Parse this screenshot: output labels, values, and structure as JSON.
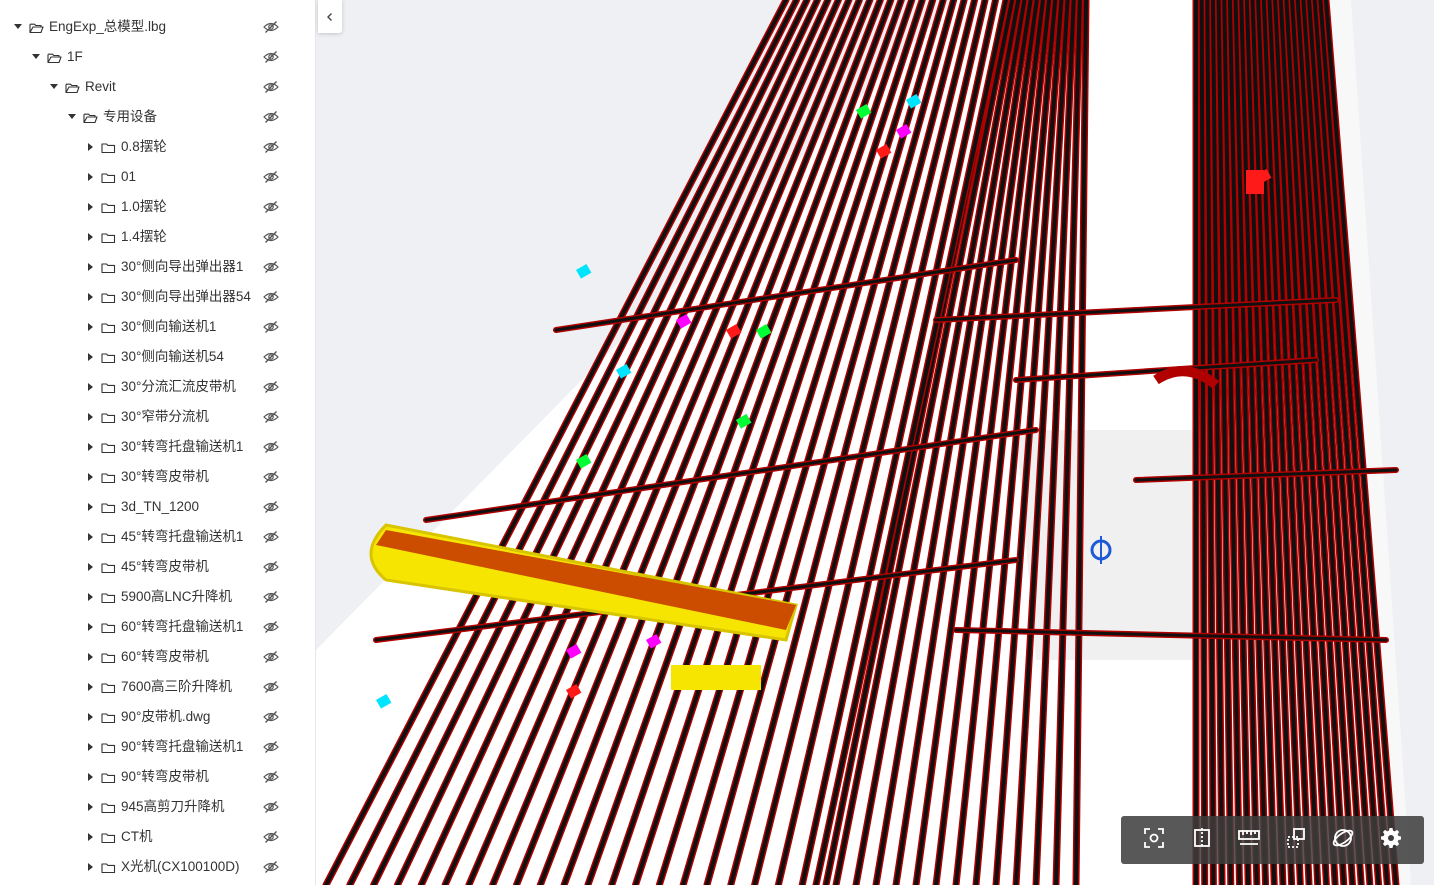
{
  "tree": {
    "items": [
      {
        "label": "EngExp_总模型.lbg",
        "level": 0,
        "expanded": true
      },
      {
        "label": "1F",
        "level": 1,
        "expanded": true
      },
      {
        "label": "Revit",
        "level": 2,
        "expanded": true
      },
      {
        "label": "专用设备",
        "level": 3,
        "expanded": true
      },
      {
        "label": "0.8摆轮",
        "level": 4,
        "expanded": false
      },
      {
        "label": "01",
        "level": 4,
        "expanded": false
      },
      {
        "label": "1.0摆轮",
        "level": 4,
        "expanded": false
      },
      {
        "label": "1.4摆轮",
        "level": 4,
        "expanded": false
      },
      {
        "label": "30°侧向导出弹出器1",
        "level": 4,
        "expanded": false
      },
      {
        "label": "30°侧向导出弹出器54",
        "level": 4,
        "expanded": false
      },
      {
        "label": "30°侧向输送机1",
        "level": 4,
        "expanded": false
      },
      {
        "label": "30°侧向输送机54",
        "level": 4,
        "expanded": false
      },
      {
        "label": "30°分流汇流皮带机",
        "level": 4,
        "expanded": false
      },
      {
        "label": "30°窄带分流机",
        "level": 4,
        "expanded": false
      },
      {
        "label": "30°转弯托盘输送机1",
        "level": 4,
        "expanded": false
      },
      {
        "label": "30°转弯皮带机",
        "level": 4,
        "expanded": false
      },
      {
        "label": "3d_TN_1200",
        "level": 4,
        "expanded": false
      },
      {
        "label": "45°转弯托盘输送机1",
        "level": 4,
        "expanded": false
      },
      {
        "label": "45°转弯皮带机",
        "level": 4,
        "expanded": false
      },
      {
        "label": "5900高LNC升降机",
        "level": 4,
        "expanded": false
      },
      {
        "label": "60°转弯托盘输送机1",
        "level": 4,
        "expanded": false
      },
      {
        "label": "60°转弯皮带机",
        "level": 4,
        "expanded": false
      },
      {
        "label": "7600高三阶升降机",
        "level": 4,
        "expanded": false
      },
      {
        "label": "90°皮带机.dwg",
        "level": 4,
        "expanded": false
      },
      {
        "label": "90°转弯托盘输送机1",
        "level": 4,
        "expanded": false
      },
      {
        "label": "90°转弯皮带机",
        "level": 4,
        "expanded": false
      },
      {
        "label": "945高剪刀升降机",
        "level": 4,
        "expanded": false
      },
      {
        "label": "CT机",
        "level": 4,
        "expanded": false
      },
      {
        "label": "X光机(CX100100D)",
        "level": 4,
        "expanded": false
      }
    ]
  },
  "icons": {
    "caret_expanded": "caret-down-icon",
    "caret_collapsed": "caret-right-icon",
    "folder_open": "folder-open-icon",
    "folder_closed": "folder-icon",
    "visibility": "eye-slash-icon",
    "collapse": "chevron-left-icon"
  },
  "toolbar": {
    "tools": [
      {
        "icon": "focus-icon"
      },
      {
        "icon": "section-box-icon"
      },
      {
        "icon": "measure-icon"
      },
      {
        "icon": "explode-icon"
      },
      {
        "icon": "orbit-icon"
      },
      {
        "icon": "settings-icon"
      }
    ]
  },
  "colors": {
    "pipe_red": "#b00000",
    "pipe_dark": "#101010",
    "highlight_yellow": "#f5e500",
    "highlight_orange": "#c83c00",
    "accent_blue": "#1e5ad6",
    "toolbar_bg": "#3c3c3c",
    "icon_gray": "#555555"
  }
}
